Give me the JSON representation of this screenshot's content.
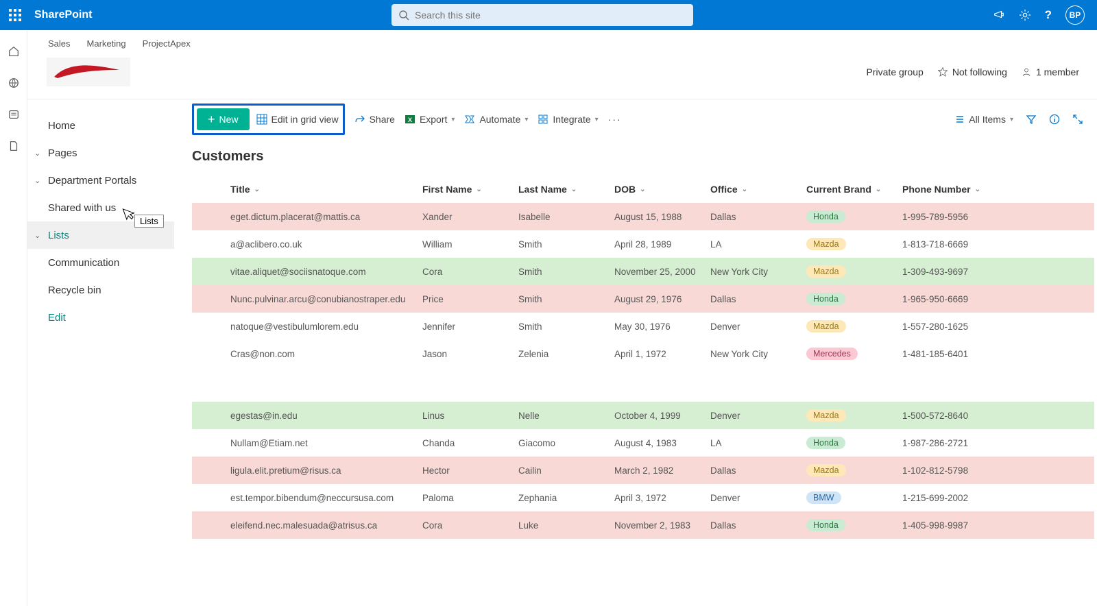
{
  "suite": {
    "app_name": "SharePoint",
    "search_placeholder": "Search this site",
    "avatar_initials": "BP"
  },
  "site_tabs": [
    "Sales",
    "Marketing",
    "ProjectApex"
  ],
  "site_meta": {
    "group": "Private group",
    "follow": "Not following",
    "members": "1 member"
  },
  "leftnav": {
    "items": [
      {
        "label": "Home",
        "chev": false
      },
      {
        "label": "Pages",
        "chev": true
      },
      {
        "label": "Department Portals",
        "chev": true
      },
      {
        "label": "Shared with us",
        "chev": false
      },
      {
        "label": "Lists",
        "chev": true,
        "selected": true
      },
      {
        "label": "Communication",
        "chev": false
      },
      {
        "label": "Recycle bin",
        "chev": false
      },
      {
        "label": "Edit",
        "chev": false,
        "teal": true
      }
    ],
    "tooltip": "Lists"
  },
  "commands": {
    "new": "New",
    "grid": "Edit in grid view",
    "share": "Share",
    "export": "Export",
    "automate": "Automate",
    "integrate": "Integrate",
    "view": "All Items"
  },
  "list": {
    "title": "Customers",
    "columns": [
      "Title",
      "First Name",
      "Last Name",
      "DOB",
      "Office",
      "Current Brand",
      "Phone Number"
    ],
    "rows": [
      {
        "c": "pink",
        "title": "eget.dictum.placerat@mattis.ca",
        "first": "Xander",
        "last": "Isabelle",
        "dob": "August 15, 1988",
        "office": "Dallas",
        "brand": "Honda",
        "phone": "1-995-789-5956"
      },
      {
        "c": "",
        "title": "a@aclibero.co.uk",
        "first": "William",
        "last": "Smith",
        "dob": "April 28, 1989",
        "office": "LA",
        "brand": "Mazda",
        "phone": "1-813-718-6669"
      },
      {
        "c": "green",
        "title": "vitae.aliquet@sociisnatoque.com",
        "first": "Cora",
        "last": "Smith",
        "dob": "November 25, 2000",
        "office": "New York City",
        "brand": "Mazda",
        "phone": "1-309-493-9697"
      },
      {
        "c": "pink",
        "title": "Nunc.pulvinar.arcu@conubianostraper.edu",
        "first": "Price",
        "last": "Smith",
        "dob": "August 29, 1976",
        "office": "Dallas",
        "brand": "Honda",
        "phone": "1-965-950-6669"
      },
      {
        "c": "",
        "title": "natoque@vestibulumlorem.edu",
        "first": "Jennifer",
        "last": "Smith",
        "dob": "May 30, 1976",
        "office": "Denver",
        "brand": "Mazda",
        "phone": "1-557-280-1625"
      },
      {
        "c": "",
        "title": "Cras@non.com",
        "first": "Jason",
        "last": "Zelenia",
        "dob": "April 1, 1972",
        "office": "New York City",
        "brand": "Mercedes",
        "phone": "1-481-185-6401"
      },
      {
        "c": "spacer"
      },
      {
        "c": "green",
        "title": "egestas@in.edu",
        "first": "Linus",
        "last": "Nelle",
        "dob": "October 4, 1999",
        "office": "Denver",
        "brand": "Mazda",
        "phone": "1-500-572-8640"
      },
      {
        "c": "",
        "title": "Nullam@Etiam.net",
        "first": "Chanda",
        "last": "Giacomo",
        "dob": "August 4, 1983",
        "office": "LA",
        "brand": "Honda",
        "phone": "1-987-286-2721"
      },
      {
        "c": "pink",
        "title": "ligula.elit.pretium@risus.ca",
        "first": "Hector",
        "last": "Cailin",
        "dob": "March 2, 1982",
        "office": "Dallas",
        "brand": "Mazda",
        "phone": "1-102-812-5798"
      },
      {
        "c": "",
        "title": "est.tempor.bibendum@neccursusa.com",
        "first": "Paloma",
        "last": "Zephania",
        "dob": "April 3, 1972",
        "office": "Denver",
        "brand": "BMW",
        "phone": "1-215-699-2002"
      },
      {
        "c": "pink",
        "title": "eleifend.nec.malesuada@atrisus.ca",
        "first": "Cora",
        "last": "Luke",
        "dob": "November 2, 1983",
        "office": "Dallas",
        "brand": "Honda",
        "phone": "1-405-998-9987"
      }
    ]
  }
}
